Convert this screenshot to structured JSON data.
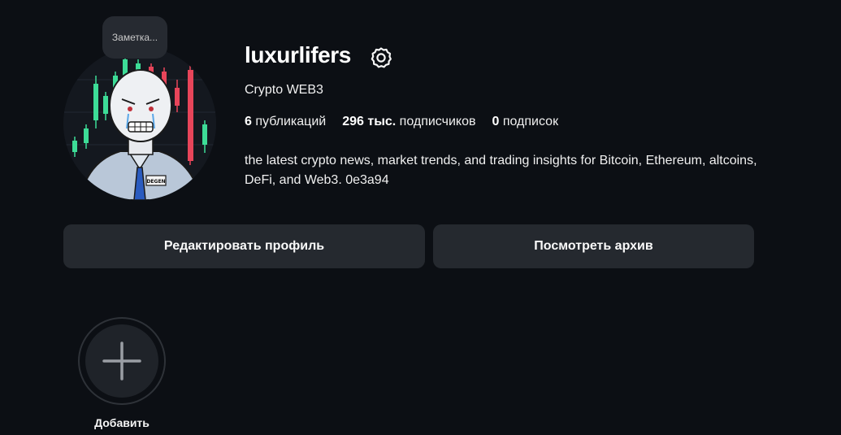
{
  "profile": {
    "note": "Заметка...",
    "username": "luxurlifers",
    "full_name": "Crypto WEB3",
    "stats": [
      {
        "count": "6",
        "label": "публикаций"
      },
      {
        "count": "296 тыс.",
        "label": "подписчиков"
      },
      {
        "count": "0",
        "label": "подписок"
      }
    ],
    "bio": "the latest crypto news, market trends, and trading insights for Bitcoin, Ethereum, altcoins, DeFi, and Web3. 0e3a94",
    "avatar_badge": "DEGEN"
  },
  "actions": {
    "edit_label": "Редактировать профиль",
    "archive_label": "Посмотреть архив"
  },
  "highlights": {
    "new_label": "Добавить",
    "new_icon": "plus-icon"
  },
  "icons": {
    "settings": "gear-icon"
  },
  "colors": {
    "background": "#0c0f14",
    "button": "#25292f",
    "candle_up": "#3ddc97",
    "candle_down": "#e8455a"
  }
}
